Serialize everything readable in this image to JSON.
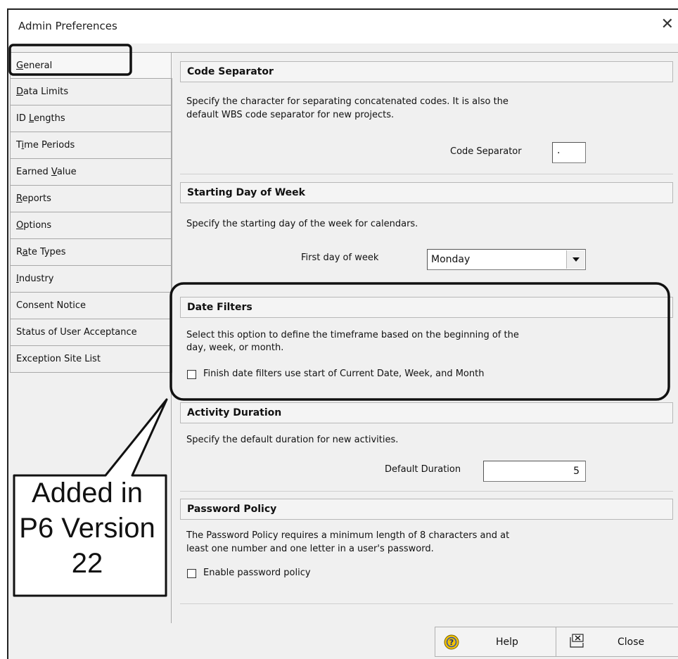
{
  "window": {
    "title": "Admin Preferences",
    "close_glyph": "✕"
  },
  "tabs": [
    {
      "pre": "",
      "key": "G",
      "post": "eneral"
    },
    {
      "pre": "",
      "key": "D",
      "post": "ata Limits"
    },
    {
      "pre": "ID ",
      "key": "L",
      "post": "engths"
    },
    {
      "pre": "T",
      "key": "i",
      "post": "me Periods"
    },
    {
      "pre": "Earned ",
      "key": "V",
      "post": "alue"
    },
    {
      "pre": "",
      "key": "R",
      "post": "eports"
    },
    {
      "pre": "",
      "key": "O",
      "post": "ptions"
    },
    {
      "pre": "R",
      "key": "a",
      "post": "te Types"
    },
    {
      "pre": "",
      "key": "I",
      "post": "ndustry"
    },
    {
      "pre": "Consent Notice",
      "key": "",
      "post": ""
    },
    {
      "pre": "Status of User Acceptance",
      "key": "",
      "post": ""
    },
    {
      "pre": "Exception Site List",
      "key": "",
      "post": ""
    }
  ],
  "sections": {
    "code_separator": {
      "header": "Code Separator",
      "description_line1": "Specify the character for separating concatenated codes.  It is also the",
      "description_line2": "default WBS code separator for new projects.",
      "field_label": "Code Separator",
      "value": "."
    },
    "starting_day": {
      "header": "Starting Day of Week",
      "description": "Specify the starting day of the week for calendars.",
      "field_label": "First day of week",
      "value": "Monday"
    },
    "date_filters": {
      "header": "Date Filters",
      "description_line1": "Select this option to define the timeframe based on the beginning of the",
      "description_line2": "day, week, or month.",
      "checkbox_label": "Finish date filters use start of Current Date, Week, and Month",
      "checked": false
    },
    "activity_duration": {
      "header": "Activity Duration",
      "description": "Specify the default duration for new activities.",
      "field_label": "Default Duration",
      "value": "5"
    },
    "password_policy": {
      "header": "Password Policy",
      "description_line1": "The Password Policy requires a minimum length of 8 characters and at",
      "description_line2": "least one number and one letter in a user's password.",
      "checkbox_label": "Enable password policy",
      "checked": false
    }
  },
  "footer": {
    "help_label": "Help",
    "close_label": "Close"
  },
  "callout": {
    "line1": "Added in",
    "line2": "P6 Version",
    "line3": "22"
  },
  "colors": {
    "dialog_bg": "#f0f0f0",
    "highlight_border": "#111111",
    "help_icon": "#f2c200"
  },
  "icons": {
    "help": "help-icon",
    "close_button": "close-window-icon",
    "dropdown": "chevron-down-icon"
  }
}
